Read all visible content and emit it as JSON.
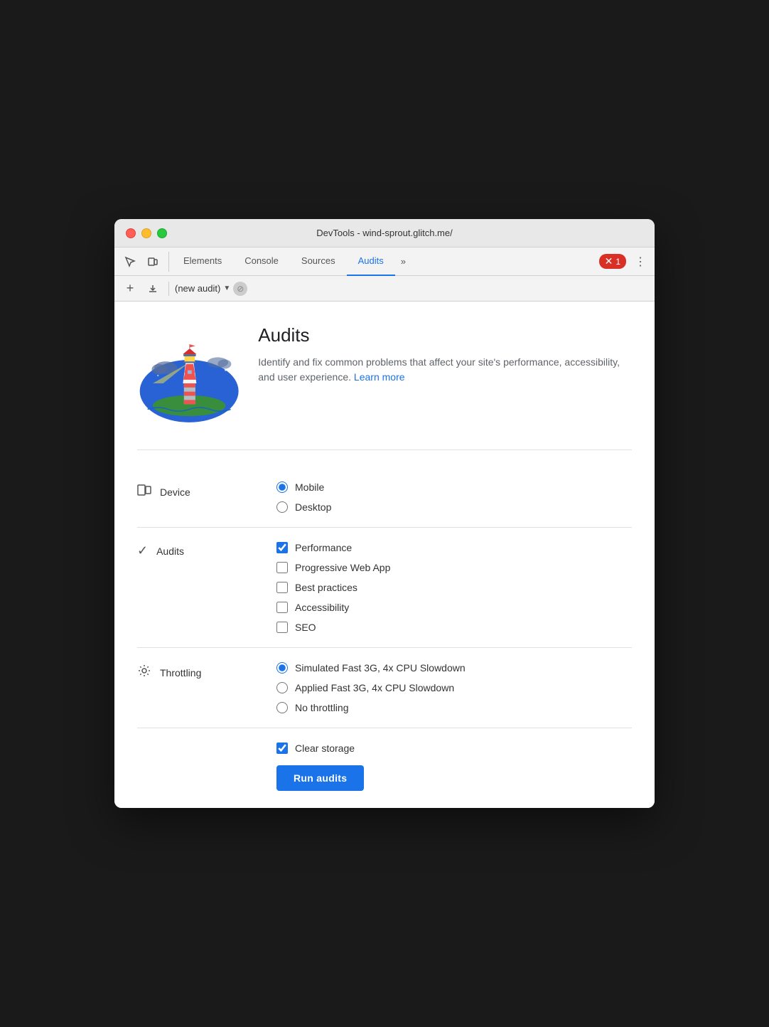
{
  "window": {
    "title": "DevTools - wind-sprout.glitch.me/"
  },
  "tabs": {
    "items": [
      {
        "label": "Elements",
        "active": false
      },
      {
        "label": "Console",
        "active": false
      },
      {
        "label": "Sources",
        "active": false
      },
      {
        "label": "Audits",
        "active": true
      }
    ],
    "more_label": "»",
    "error_count": "1"
  },
  "toolbar": {
    "new_audit_label": "(new audit)"
  },
  "hero": {
    "title": "Audits",
    "description": "Identify and fix common problems that affect your site's performance, accessibility, and user experience.",
    "learn_more": "Learn more"
  },
  "device": {
    "label": "Device",
    "options": [
      {
        "label": "Mobile",
        "checked": true
      },
      {
        "label": "Desktop",
        "checked": false
      }
    ]
  },
  "audits": {
    "label": "Audits",
    "options": [
      {
        "label": "Performance",
        "checked": true
      },
      {
        "label": "Progressive Web App",
        "checked": false
      },
      {
        "label": "Best practices",
        "checked": false
      },
      {
        "label": "Accessibility",
        "checked": false
      },
      {
        "label": "SEO",
        "checked": false
      }
    ]
  },
  "throttling": {
    "label": "Throttling",
    "options": [
      {
        "label": "Simulated Fast 3G, 4x CPU Slowdown",
        "checked": true
      },
      {
        "label": "Applied Fast 3G, 4x CPU Slowdown",
        "checked": false
      },
      {
        "label": "No throttling",
        "checked": false
      }
    ]
  },
  "bottom": {
    "clear_storage_label": "Clear storage",
    "clear_storage_checked": true,
    "run_button": "Run audits"
  }
}
